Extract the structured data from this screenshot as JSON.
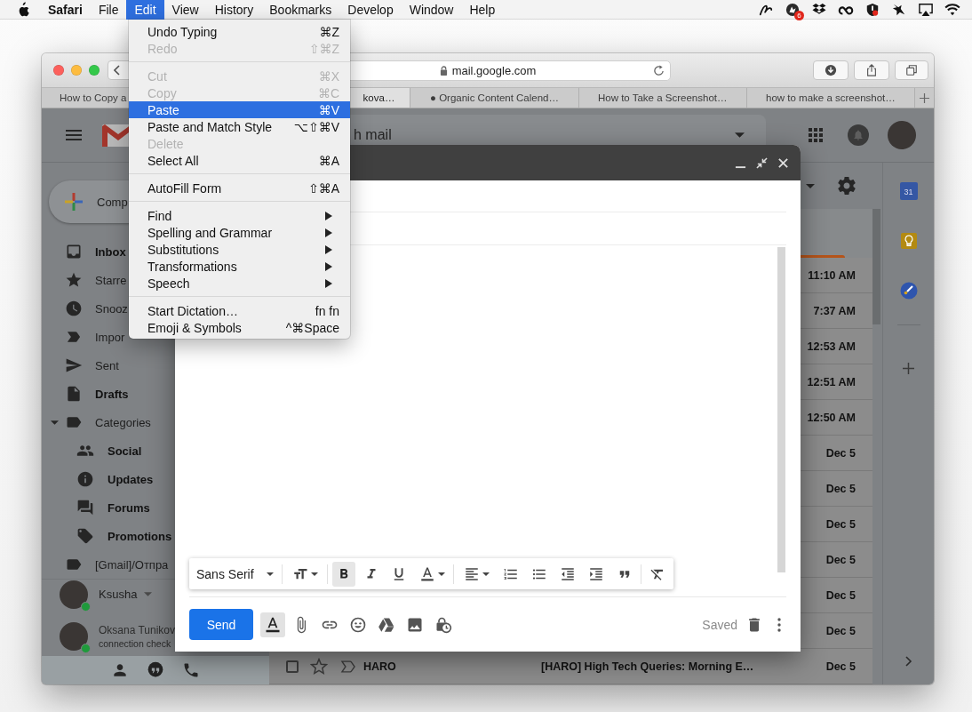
{
  "menu_bar": {
    "app_name": "Safari",
    "menus": [
      {
        "label": "File",
        "selected": false
      },
      {
        "label": "Edit",
        "selected": true
      },
      {
        "label": "View",
        "selected": false
      },
      {
        "label": "History",
        "selected": false
      },
      {
        "label": "Bookmarks",
        "selected": false
      },
      {
        "label": "Develop",
        "selected": false
      },
      {
        "label": "Window",
        "selected": false
      },
      {
        "label": "Help",
        "selected": false
      }
    ],
    "badge": "6"
  },
  "browser": {
    "address": "mail.google.com",
    "tabs": [
      {
        "title": "How to Copy a",
        "selected": false
      },
      {
        "title": "kova…",
        "selected": true
      },
      {
        "title": "● Organic Content Calend…",
        "selected": false
      },
      {
        "title": "How to Take a Screenshot…",
        "selected": false
      },
      {
        "title": "how to make a screenshot…",
        "selected": false
      }
    ]
  },
  "gmail": {
    "search": {
      "placeholder": "h mail"
    },
    "compose_button": "Comp",
    "nav": [
      {
        "label": "Inbox",
        "unread": true
      },
      {
        "label": "Starre",
        "unread": false
      },
      {
        "label": "Snooz",
        "unread": false
      },
      {
        "label": "Impor",
        "unread": false
      },
      {
        "label": "Sent",
        "unread": false
      },
      {
        "label": "Drafts",
        "unread": true
      },
      {
        "label": "Categories",
        "unread": false,
        "expanded": true,
        "children": [
          {
            "label": "Social",
            "unread": true
          },
          {
            "label": "Updates",
            "unread": true
          },
          {
            "label": "Forums",
            "unread": true
          },
          {
            "label": "Promotions",
            "unread": true
          }
        ]
      },
      {
        "label": "[Gmail]/Отпра",
        "unread": false
      }
    ],
    "hangouts": [
      {
        "kind": "account",
        "name": "Ksusha",
        "online": true
      },
      {
        "kind": "contact",
        "name": "Oksana Tunikov",
        "status": "connection check",
        "online": true
      }
    ],
    "mail_rows": [
      {
        "time": "11:10 AM",
        "unread": true
      },
      {
        "time": "7:37 AM",
        "unread": true
      },
      {
        "time": "12:53 AM",
        "unread": true
      },
      {
        "time": "12:51 AM",
        "unread": true
      },
      {
        "time": "12:50 AM",
        "unread": true
      },
      {
        "time": "Dec 5",
        "unread": true
      },
      {
        "time": "Dec 5",
        "unread": true
      },
      {
        "time": "Dec 5",
        "unread": true
      },
      {
        "time": "Dec 5",
        "unread": true
      },
      {
        "time": "Dec 5",
        "unread": true
      },
      {
        "time": "Dec 5",
        "unread": true
      },
      {
        "sender": "HARO",
        "subject": "[HARO] High Tech Queries: Morning E…",
        "time": "Dec 5",
        "unread": true,
        "checked": false,
        "starred": false,
        "important": false
      }
    ],
    "side_panel": {
      "calendar_date": "31"
    }
  },
  "compose": {
    "font": "Sans Serif",
    "bold": true,
    "formatting_open": true,
    "send_label": "Send",
    "status": "Saved"
  },
  "edit_menu": {
    "items": [
      {
        "kind": "item",
        "label": "Undo Typing",
        "shortcut": "⌘Z",
        "disabled": false,
        "selected": false,
        "submenu": false
      },
      {
        "kind": "item",
        "label": "Redo",
        "shortcut": "⇧⌘Z",
        "disabled": true,
        "selected": false,
        "submenu": false
      },
      {
        "kind": "separator"
      },
      {
        "kind": "item",
        "label": "Cut",
        "shortcut": "⌘X",
        "disabled": true,
        "selected": false,
        "submenu": false
      },
      {
        "kind": "item",
        "label": "Copy",
        "shortcut": "⌘C",
        "disabled": true,
        "selected": false,
        "submenu": false
      },
      {
        "kind": "item",
        "label": "Paste",
        "shortcut": "⌘V",
        "disabled": false,
        "selected": true,
        "submenu": false
      },
      {
        "kind": "item",
        "label": "Paste and Match Style",
        "shortcut": "⌥⇧⌘V",
        "disabled": false,
        "selected": false,
        "submenu": false
      },
      {
        "kind": "item",
        "label": "Delete",
        "disabled": true,
        "selected": false,
        "submenu": false
      },
      {
        "kind": "item",
        "label": "Select All",
        "shortcut": "⌘A",
        "disabled": false,
        "selected": false,
        "submenu": false
      },
      {
        "kind": "separator"
      },
      {
        "kind": "item",
        "label": "AutoFill Form",
        "shortcut": "⇧⌘A",
        "disabled": false,
        "selected": false,
        "submenu": false
      },
      {
        "kind": "separator"
      },
      {
        "kind": "item",
        "label": "Find",
        "disabled": false,
        "selected": false,
        "submenu": true
      },
      {
        "kind": "item",
        "label": "Spelling and Grammar",
        "disabled": false,
        "selected": false,
        "submenu": true
      },
      {
        "kind": "item",
        "label": "Substitutions",
        "disabled": false,
        "selected": false,
        "submenu": true
      },
      {
        "kind": "item",
        "label": "Transformations",
        "disabled": false,
        "selected": false,
        "submenu": true
      },
      {
        "kind": "item",
        "label": "Speech",
        "disabled": false,
        "selected": false,
        "submenu": true
      },
      {
        "kind": "separator"
      },
      {
        "kind": "item",
        "label": "Start Dictation…",
        "shortcut": "fn fn",
        "disabled": false,
        "selected": false,
        "submenu": false
      },
      {
        "kind": "item",
        "label": "Emoji & Symbols",
        "shortcut": "^⌘Space",
        "disabled": false,
        "selected": false,
        "submenu": false
      }
    ]
  }
}
